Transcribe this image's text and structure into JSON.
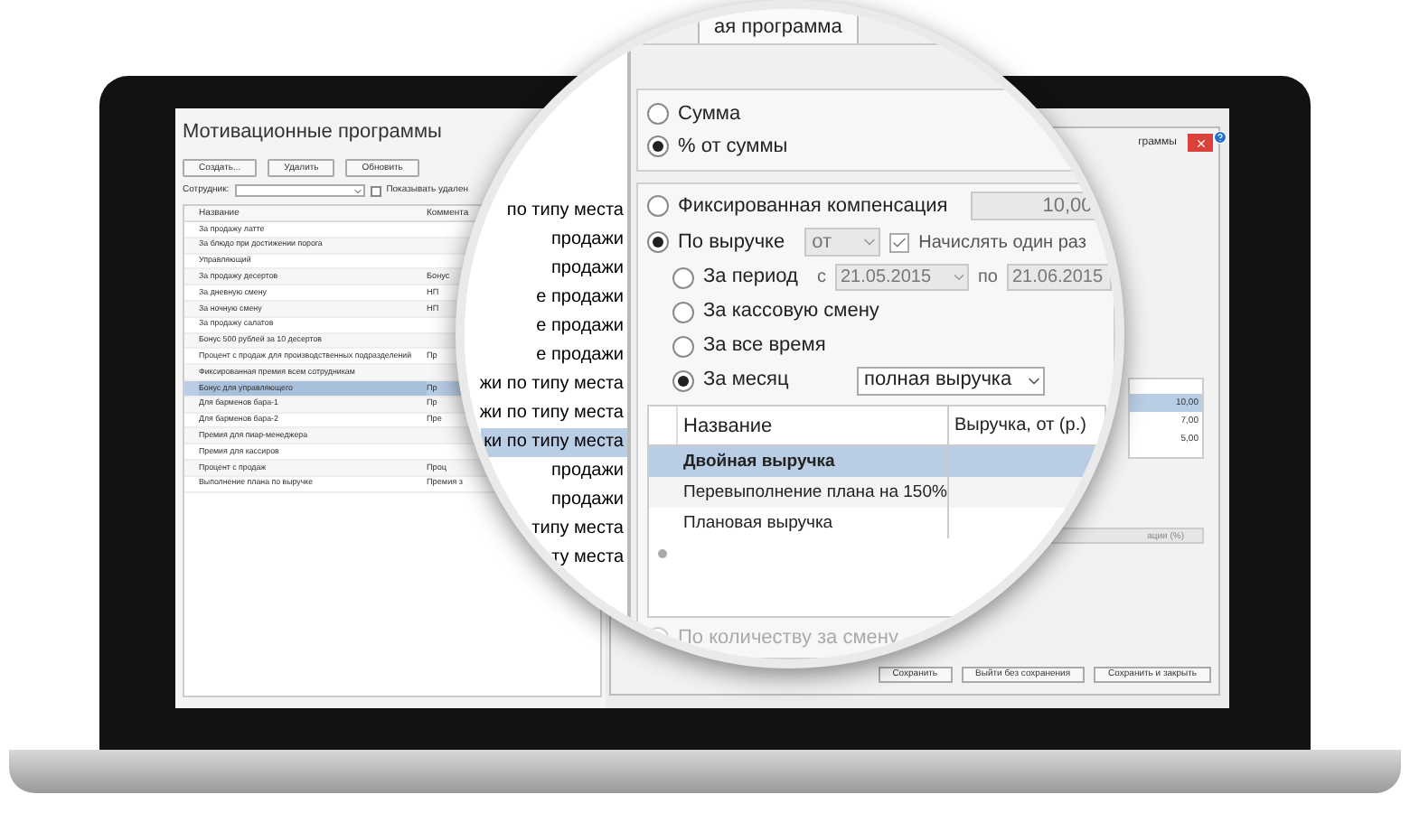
{
  "main_window": {
    "title": "Мотивационные программы",
    "buttons": [
      "Создать...",
      "Удалить",
      "Обновить"
    ],
    "filter": {
      "label": "Сотрудник:",
      "checkbox": {
        "label": "Показывать удален",
        "checked": false
      }
    },
    "table": {
      "columns": [
        "Название",
        "Коммента"
      ],
      "rows": [
        {
          "name": "За продажу латте",
          "selected": false
        },
        {
          "name": "За блюдо при достижении порога",
          "selected": false
        },
        {
          "name": "Управляющий",
          "selected": false
        },
        {
          "name": "За продажу десертов",
          "comment": "Бонус",
          "selected": false
        },
        {
          "name": "За дневную смену",
          "comment": "НП",
          "selected": false
        },
        {
          "name": "За ночную смену",
          "comment": "НП",
          "selected": false
        },
        {
          "name": "За продажу салатов",
          "selected": false
        },
        {
          "name": "Бонус 500 рублей за 10 десертов",
          "selected": false
        },
        {
          "name": "Процент с продаж для производственных подразделений",
          "comment": "Пр",
          "selected": false
        },
        {
          "name": "Фиксированная премия всем сотрудникам",
          "selected": false
        },
        {
          "name": "Бонус для управляющего",
          "comment": "Пр",
          "selected": true
        },
        {
          "name": "Для барменов бара-1",
          "comment": "Пр",
          "selected": false
        },
        {
          "name": "Для барменов бара-2",
          "comment": "Пре",
          "selected": false
        },
        {
          "name": "Премия для пиар-менеджера",
          "selected": false
        },
        {
          "name": "Премия для кассиров",
          "selected": false
        },
        {
          "name": "Процент с продаж",
          "comment": "Проц",
          "selected": false
        },
        {
          "name": "Выполнение плана по выручке",
          "comment": "Премия з",
          "selected": false
        }
      ]
    }
  },
  "dialog": {
    "title": "граммы",
    "values": [
      {
        "text": "10,00",
        "selected": true
      },
      {
        "text": "7,00",
        "selected": false
      },
      {
        "text": "5,00",
        "selected": false
      }
    ],
    "column_caption": "ации (%)",
    "buttons": [
      "Сохранить",
      "Выйти без сохранения",
      "Сохранить и закрыть"
    ]
  },
  "magnifier": {
    "comment_fragments": [
      {
        "text": "по типу места",
        "selected": false
      },
      {
        "text": "продажи",
        "selected": false
      },
      {
        "text": "продажи",
        "selected": false
      },
      {
        "text": "е продажи",
        "selected": false
      },
      {
        "text": "е продажи",
        "selected": false
      },
      {
        "text": "е продажи",
        "selected": false
      },
      {
        "text": "жи по типу места",
        "selected": false
      },
      {
        "text": "жи по типу места",
        "selected": false
      },
      {
        "text": "ки по типу места",
        "selected": true
      },
      {
        "text": "продажи",
        "selected": false
      },
      {
        "text": "продажи",
        "selected": false
      },
      {
        "text": "типу места",
        "selected": false
      },
      {
        "text": "ту места",
        "selected": false
      }
    ],
    "tab": {
      "label": "ая программа",
      "selected": true
    },
    "amount_type": [
      {
        "label": "Сумма",
        "selected": false
      },
      {
        "label": "% от суммы",
        "selected": true
      }
    ],
    "fixed": {
      "label": "Фиксированная компенсация",
      "selected": false,
      "value": "10,00"
    },
    "revenue": {
      "label": "По выручке",
      "selected": true,
      "condition": "от",
      "once": {
        "label": "Начислять один раз",
        "checked": true
      }
    },
    "periods": [
      {
        "kind": "range",
        "label": "За период",
        "selected": false,
        "from_label": "с",
        "from": "21.05.2015",
        "to_label": "по",
        "to": "21.06.2015"
      },
      {
        "kind": "plain",
        "label": "За кассовую смену",
        "selected": false
      },
      {
        "kind": "plain",
        "label": "За все время",
        "selected": false
      },
      {
        "kind": "select",
        "label": "За месяц",
        "selected": true,
        "value": "полная выручка"
      }
    ],
    "table": {
      "columns": [
        "Название",
        "Выручка, от (р.)"
      ],
      "rows": [
        {
          "name": "Двойная выручка",
          "selected": true
        },
        {
          "name": "Перевыполнение плана на 150%",
          "selected": false
        },
        {
          "name": "Плановая выручка",
          "selected": false
        }
      ]
    },
    "per_shift": {
      "label": "По количеству за смену",
      "disabled": true
    }
  }
}
